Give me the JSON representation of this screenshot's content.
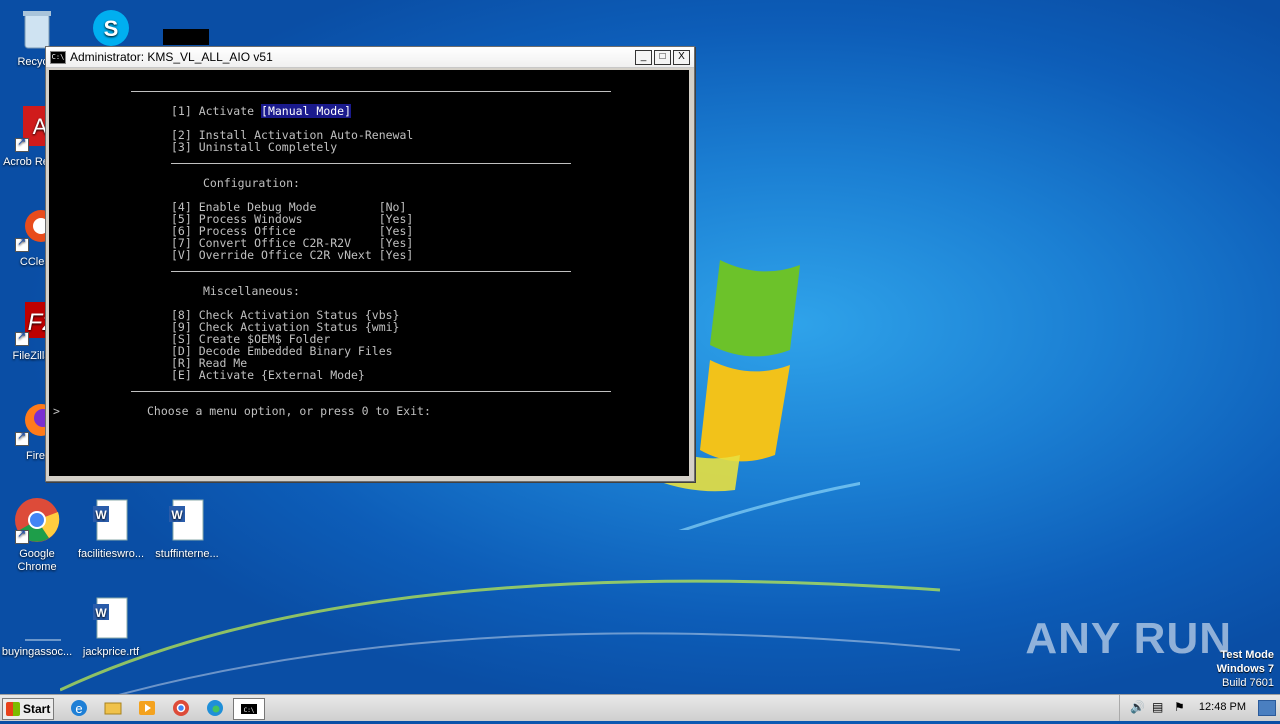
{
  "desktop": {
    "icons": [
      {
        "label": "Recycle",
        "name": "recycle-bin-icon"
      },
      {
        "label": "Acrob Reader",
        "name": "acrobat-reader-icon"
      },
      {
        "label": "CClear",
        "name": "ccleaner-icon"
      },
      {
        "label": "FileZilla C",
        "name": "filezilla-icon"
      },
      {
        "label": "Firef",
        "name": "firefox-icon"
      },
      {
        "label": "Google Chrome",
        "name": "chrome-icon"
      },
      {
        "label": "facilitieswro...",
        "name": "word-doc-icon"
      },
      {
        "label": "stuffinterne...",
        "name": "word-doc-icon"
      },
      {
        "label": "buyingassoc...",
        "name": "blank-file-icon"
      },
      {
        "label": "jackprice.rtf",
        "name": "word-doc-icon"
      }
    ],
    "watermark": "ANY RUN",
    "os_info": [
      "Test Mode",
      "Windows 7",
      "Build 7601"
    ]
  },
  "window": {
    "title": "Administrator:  KMS_VL_ALL_AIO v51",
    "buttons": [
      "_",
      "□",
      "X"
    ]
  },
  "console": {
    "lines": [
      {
        "text": "[1] Activate ",
        "hl": "[Manual Mode]"
      },
      {
        "text": "[2] Install Activation Auto-Renewal"
      },
      {
        "text": "[3] Uninstall Completely"
      },
      {
        "text": "Configuration:"
      },
      {
        "text": "[4] Enable Debug Mode         [No]"
      },
      {
        "text": "[5] Process Windows           [Yes]"
      },
      {
        "text": "[6] Process Office            [Yes]"
      },
      {
        "text": "[7] Convert Office C2R-R2V    [Yes]"
      },
      {
        "text": "[V] Override Office C2R vNext [Yes]"
      },
      {
        "text": "Miscellaneous:"
      },
      {
        "text": "[8] Check Activation Status {vbs}"
      },
      {
        "text": "[9] Check Activation Status {wmi}"
      },
      {
        "text": "[S] Create $OEM$ Folder"
      },
      {
        "text": "[D] Decode Embedded Binary Files"
      },
      {
        "text": "[R] Read Me"
      },
      {
        "text": "[E] Activate {External Mode}"
      }
    ],
    "prompt": "Choose a menu option, or press 0 to Exit:"
  },
  "taskbar": {
    "start_label": "Start",
    "clock": "12:48 PM"
  },
  "colors": {
    "console_bg": "#000000",
    "console_fg": "#c0c0c0",
    "highlight": "#1a1a8c",
    "desktop": "#1b7fd3"
  }
}
